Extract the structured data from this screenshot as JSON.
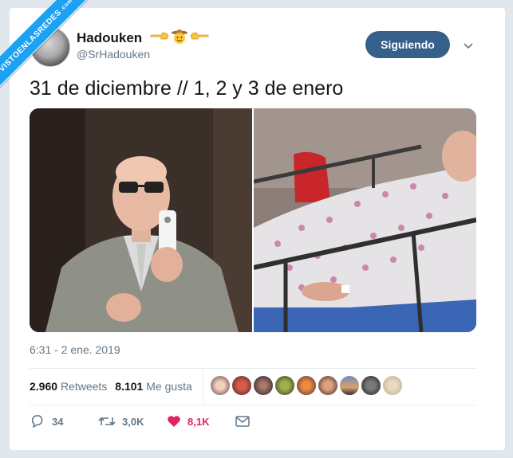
{
  "watermark": {
    "text": "VISTOENLASREDES",
    "suffix": ".com"
  },
  "user": {
    "name": "Hadouken",
    "handle": "@SrHadouken"
  },
  "follow_button": "Siguiendo",
  "tweet": {
    "text": "31 de diciembre // 1, 2 y 3 de enero",
    "timestamp": "6:31 - 2 ene. 2019"
  },
  "stats": {
    "retweets_count": "2.960",
    "retweets_label": "Retweets",
    "likes_count": "8.101",
    "likes_label": "Me gusta"
  },
  "actions": {
    "reply_count": "34",
    "retweet_count": "3,0K",
    "like_count": "8,1K"
  },
  "colors": {
    "accent": "#1da1f2",
    "follow": "#365f8a",
    "like": "#e0245e",
    "muted": "#657786"
  },
  "icons": [
    "pointing-hand-left-icon",
    "cowboy-emoji-icon",
    "pointing-hand-right-icon",
    "chevron-down-icon",
    "reply-icon",
    "retweet-icon",
    "heart-icon",
    "mail-icon"
  ]
}
